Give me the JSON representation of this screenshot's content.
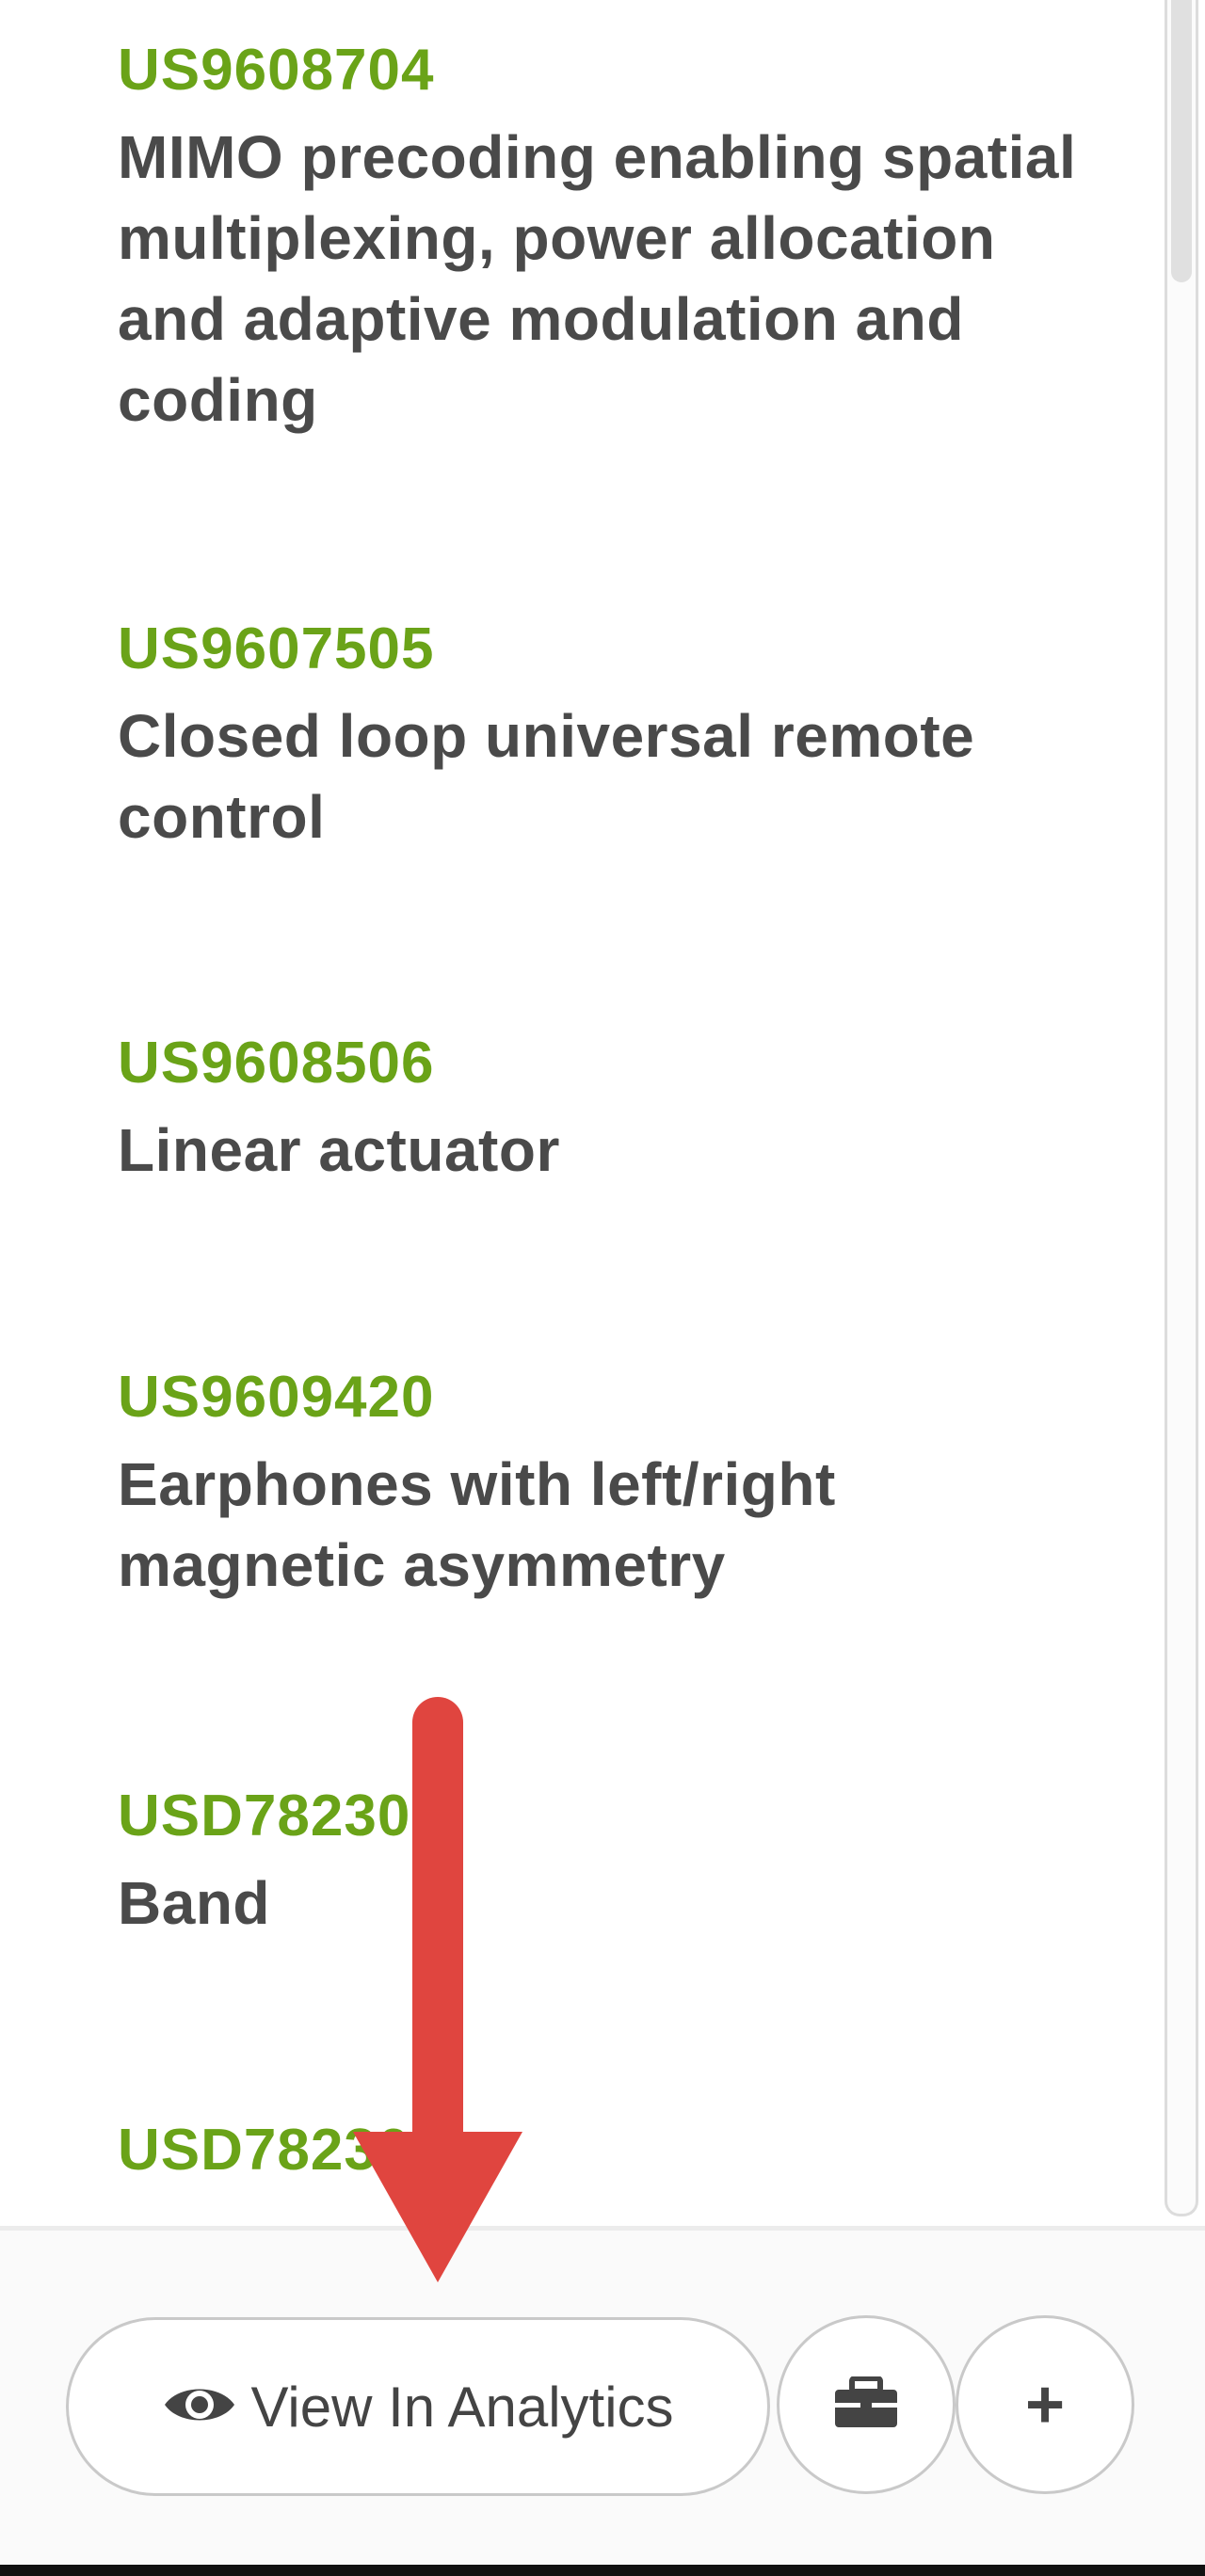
{
  "patents": [
    {
      "id": "US9608704",
      "title": "MIMO precoding enabling spatial multiplexing, power allocation and adaptive modulation and coding"
    },
    {
      "id": "US9607505",
      "title": "Closed loop universal remote control"
    },
    {
      "id": "US9608506",
      "title": "Linear actuator"
    },
    {
      "id": "US9609420",
      "title": "Earphones with left/right magnetic asymmetry"
    },
    {
      "id": "USD782308",
      "title": "Band"
    },
    {
      "id": "USD782309",
      "title": ""
    }
  ],
  "footer": {
    "view_analytics_label": "View In Analytics",
    "view_analytics_icon": "eye-icon",
    "briefcase_icon": "briefcase-icon",
    "add_icon": "plus-icon",
    "add_label": "+"
  },
  "colors": {
    "patent_id": "#6aa318",
    "patent_title": "#4a4a4a",
    "annotation_arrow": "#e0453f"
  }
}
